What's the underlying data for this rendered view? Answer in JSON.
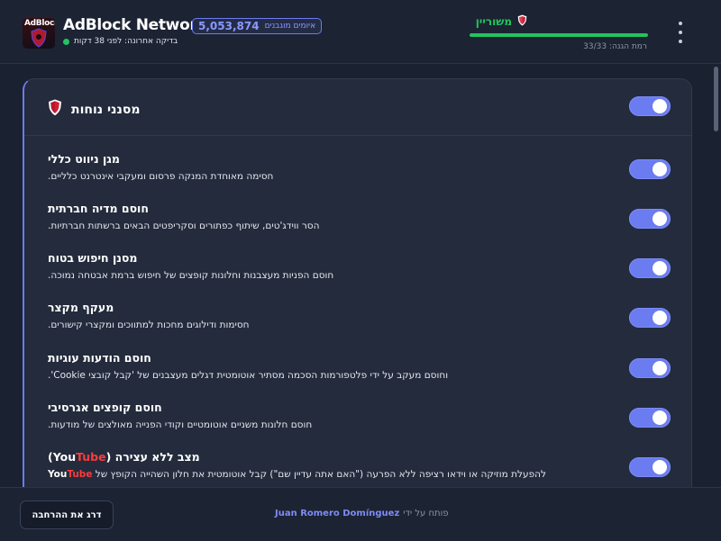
{
  "header": {
    "app_title": "AdBlock Network",
    "logo_text": "AdBlock",
    "threat_count": "5,053,874",
    "threat_label": "איומים מוגבנים",
    "last_check": "בדיקה אחרונה: לפני 38 דקות",
    "status_text": "משוריין",
    "protection_level_label": "רמת הגנה: 33/33",
    "protection_progress": 1.0
  },
  "card": {
    "title": "מסנני נוחות",
    "filters": [
      {
        "title": "מגן ניווט כללי",
        "desc": "חסימה מאוחדת המנקה פרסום ומעקבי אינטרנט כלליים.",
        "enabled": true
      },
      {
        "title": "חוסם מדיה חברתית",
        "desc": "הסר ווידג'טים, שיתוף כפתורים וסקריפטים הבאים ברשתות חברתיות.",
        "enabled": true
      },
      {
        "title": "מסנן חיפוש בטוח",
        "desc": "חוסם הפניות מעצבנות וחלונות קופצים של חיפוש ברמת אבטחה נמוכה.",
        "enabled": true
      },
      {
        "title": "מעקף מקצר",
        "desc": "חסימות ודילוגים מחכות למתווכים ומקצרי קישורים.",
        "enabled": true
      },
      {
        "title": "חוסם הודעות עוגיות",
        "desc": "וחוסם מעקב על ידי פלטפורמות הסכמה מסתיר אוטומטית דגלים מעצבנים של 'קבל קובצי Cookie'.",
        "enabled": true
      },
      {
        "title": "חוסם קופצים אגרסיבי",
        "desc": "חוסם חלונות משניים אוטומטיים וקודי הפנייה מאולצים של מודעות.",
        "enabled": true
      },
      {
        "title": "מצב ללא עצירה",
        "title_suffix_you": "You",
        "title_suffix_tube": "Tube",
        "desc_part1": "להפעלת מוזיקה או וידאו רציפה ללא הפרעה (\"האם אתה עדיין שם\") קבל אוטומטית את חלון השהייה הקופץ של",
        "desc_you": "You",
        "desc_tube": "Tube",
        "enabled": true
      }
    ]
  },
  "footer": {
    "rate_button": "דרג את ההרחבה",
    "credit_prefix": "פותח על ידי",
    "author": "Juan Romero Domínguez"
  },
  "colors": {
    "accent": "#6b7bf0",
    "success": "#22c55e",
    "youtube_red": "#ff3b3b",
    "background": "#1a2130"
  },
  "icons": {
    "logo": "adblock-shield-logo",
    "status": "shield-icon",
    "card": "shield-icon",
    "menu": "kebab-menu-icon"
  }
}
